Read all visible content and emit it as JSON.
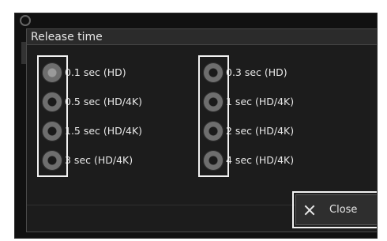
{
  "dialog": {
    "title": "Release time",
    "options_left": [
      {
        "label": "0.1 sec (HD)",
        "selected": true
      },
      {
        "label": "0.5 sec (HD/4K)",
        "selected": false
      },
      {
        "label": "1.5 sec (HD/4K)",
        "selected": false
      },
      {
        "label": "3 sec (HD/4K)",
        "selected": false
      }
    ],
    "options_right": [
      {
        "label": "0.3 sec (HD)",
        "selected": false
      },
      {
        "label": "1 sec (HD/4K)",
        "selected": false
      },
      {
        "label": "2 sec (HD/4K)",
        "selected": false
      },
      {
        "label": "4 sec (HD/4K)",
        "selected": false
      }
    ],
    "close_label": "Close"
  },
  "colors": {
    "dialog_bg": "#1c1c1c",
    "title_bg": "#2b2b2b",
    "highlight_frame": "#f2f2f2"
  }
}
